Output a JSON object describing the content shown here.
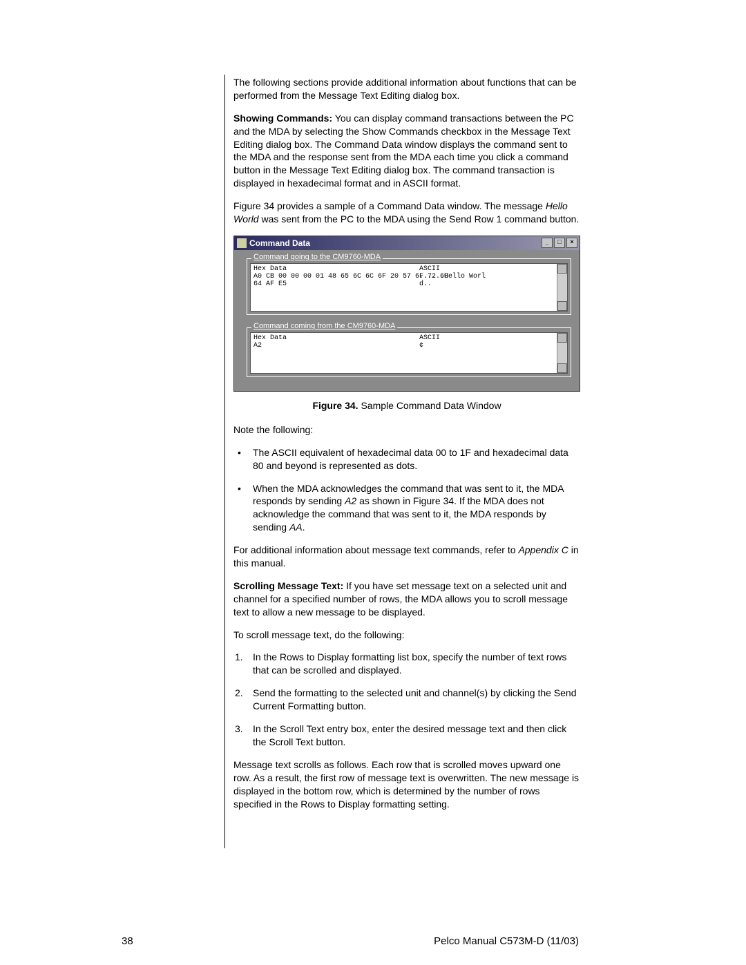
{
  "para1": "The following sections provide additional information about functions that can be performed from the Message Text Editing dialog box.",
  "show_cmds_label": "Showing Commands:",
  "show_cmds_text": " You can display command transactions between the PC and the MDA by selecting the Show Commands checkbox in the Message Text Editing dialog box. The Command Data window displays the command sent to the MDA and the response sent from the MDA each time you click a command button in the Message Text Editing dialog box. The command transaction is displayed in hexadecimal format and in ASCII format.",
  "para3a": "Figure 34 provides a sample of a Command Data window. The message ",
  "para3_hw": "Hello World",
  "para3b": " was sent from the PC to the MDA using the Send Row 1 command button.",
  "window": {
    "title": "Command Data",
    "group_going": "Command going to the CM9760-MDA",
    "group_coming": "Command coming from the CM9760-MDA",
    "hex_label": "Hex Data",
    "ascii_label": "ASCII",
    "going_hex_l1": "A0 CB 00 00 00 01 48 65 6C 6C 6F 20 57 6F 72 6C",
    "going_ascii_l1": "......Hello Worl",
    "going_hex_l2": "64 AF E5",
    "going_ascii_l2": "d..",
    "coming_hex_l1": "A2",
    "coming_ascii_l1": "¢"
  },
  "caption_bold": "Figure 34.",
  "caption_rest": "  Sample Command Data Window",
  "note_following": "Note the following:",
  "bul1": "The ASCII equivalent of hexadecimal data 00 to 1F and hexadecimal data 80 and beyond is represented as dots.",
  "bul2a": "When the MDA acknowledges the command that was sent to it, the MDA responds by sending ",
  "bul2_a2": "A2",
  "bul2b": " as shown in Figure 34. If the MDA does not acknowledge the command that was sent to it, the MDA responds by sending ",
  "bul2_aa": "AA",
  "bul2c": ".",
  "para_addl_a": "For additional information about message text commands, refer to ",
  "para_addl_apx": "Appendix C",
  "para_addl_b": " in this manual.",
  "scroll_label": "Scrolling Message Text:",
  "scroll_text": " If you have set message text on a selected unit and channel for a specified number of rows, the MDA allows you to scroll message text to allow a new message to be displayed.",
  "to_scroll": "To scroll message text, do the following:",
  "ol1": "In the Rows to Display formatting list box, specify the number of text rows that can be scrolled and displayed.",
  "ol2": "Send the formatting to the selected unit and channel(s) by clicking the Send Current Formatting button.",
  "ol3": "In the Scroll Text entry box, enter the desired message text and then click the Scroll Text button.",
  "para_last": "Message text scrolls as follows. Each row that is scrolled moves upward one row. As a result, the first row of message text is overwritten. The new message is displayed in the bottom row, which is determined by the number of rows specified in the Rows to Display formatting setting.",
  "page_num": "38",
  "footer_right": "Pelco Manual C573M-D (11/03)"
}
